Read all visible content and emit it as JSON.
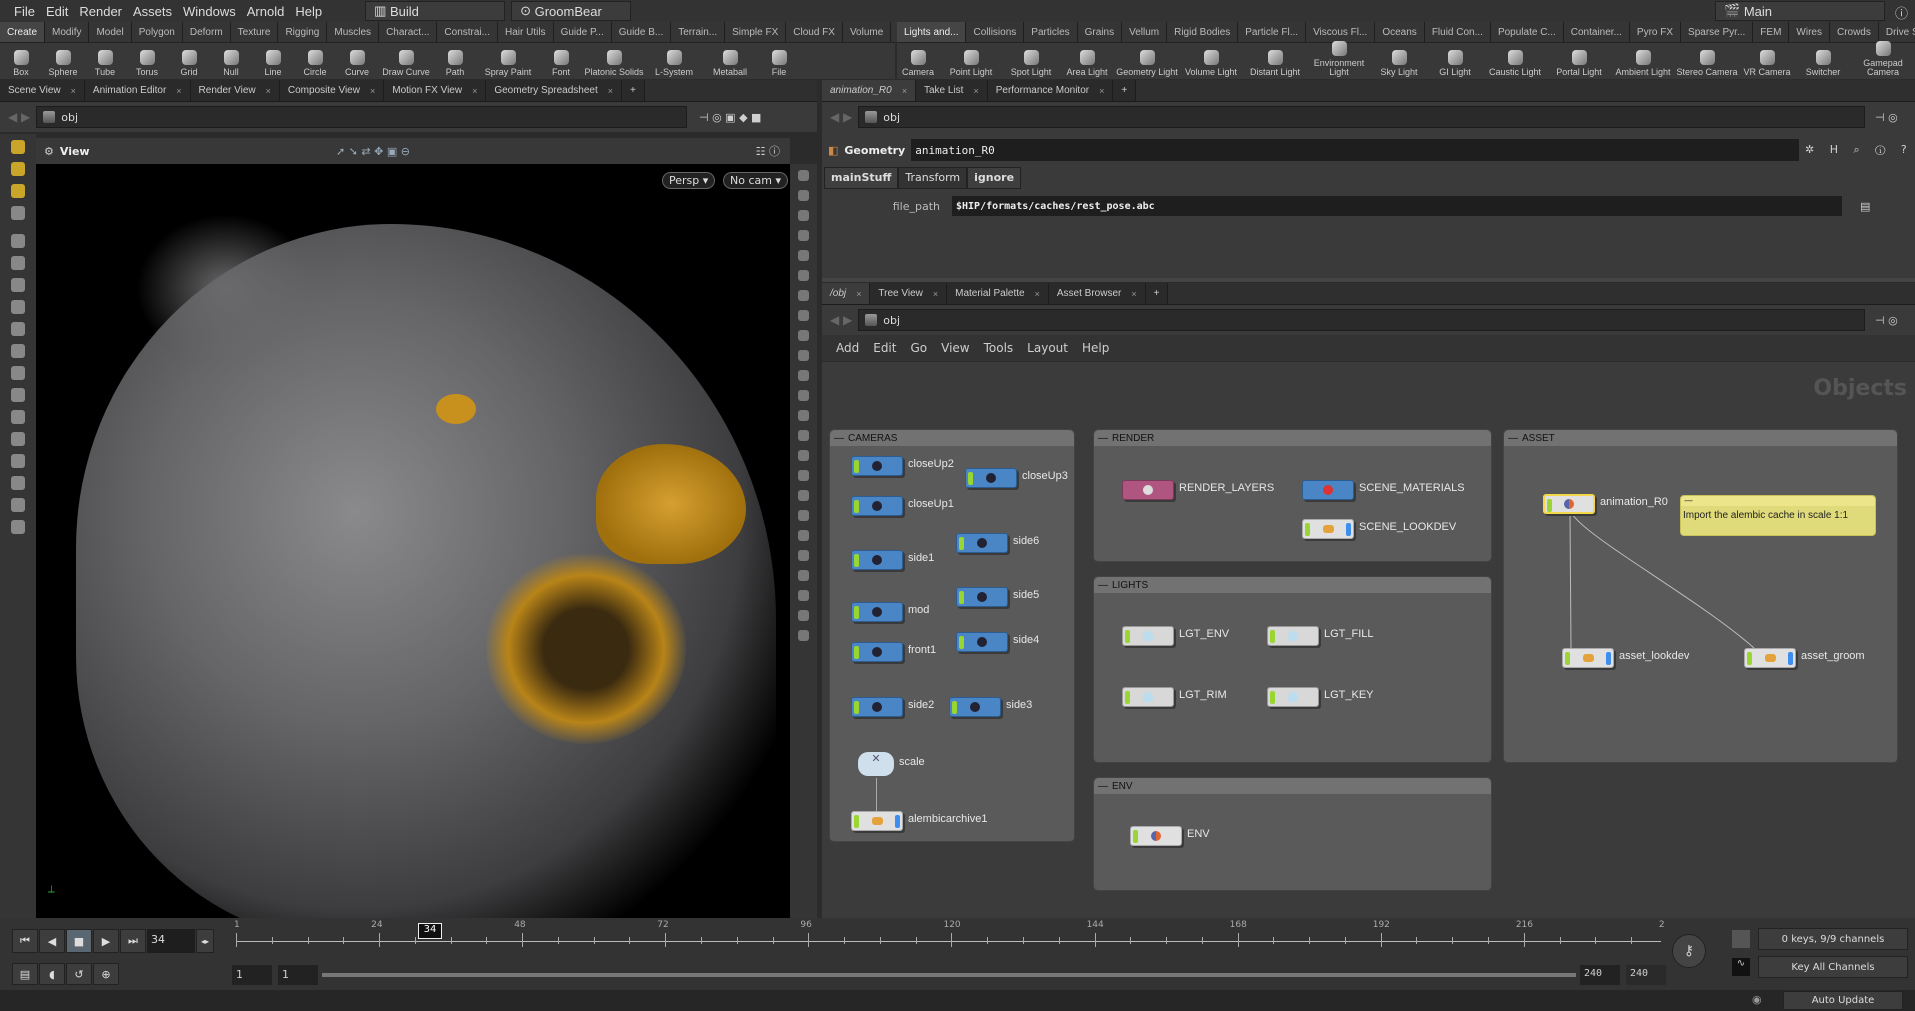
{
  "menu": [
    "File",
    "Edit",
    "Render",
    "Assets",
    "Windows",
    "Arnold",
    "Help"
  ],
  "desktop": "Build",
  "scene": "GroomBear",
  "main_desktop": "Main",
  "shelf_left": {
    "tabs": [
      "Create",
      "Modify",
      "Model",
      "Polygon",
      "Deform",
      "Texture",
      "Rigging",
      "Muscles",
      "Charact...",
      "Constrai...",
      "Hair Utils",
      "Guide P...",
      "Guide B...",
      "Terrain...",
      "Simple FX",
      "Cloud FX",
      "Volume"
    ],
    "tools": [
      "Box",
      "Sphere",
      "Tube",
      "Torus",
      "Grid",
      "Null",
      "Line",
      "Circle",
      "Curve",
      "Draw Curve",
      "Path",
      "Spray Paint",
      "Font",
      "Platonic Solids",
      "L-System",
      "Metaball",
      "File"
    ]
  },
  "shelf_right": {
    "tabs": [
      "Lights and...",
      "Collisions",
      "Particles",
      "Grains",
      "Vellum",
      "Rigid Bodies",
      "Particle Fl...",
      "Viscous Fl...",
      "Oceans",
      "Fluid Con...",
      "Populate C...",
      "Container...",
      "Pyro FX",
      "Sparse Pyr...",
      "FEM",
      "Wires",
      "Crowds",
      "Drive Sim..."
    ],
    "tools": [
      "Camera",
      "Point Light",
      "Spot Light",
      "Area Light",
      "Geometry Light",
      "Volume Light",
      "Distant Light",
      "Environment Light",
      "Sky Light",
      "GI Light",
      "Caustic Light",
      "Portal Light",
      "Ambient Light",
      "Stereo Camera",
      "VR Camera",
      "Switcher",
      "Gamepad Camera"
    ]
  },
  "left_pane": {
    "tabs": [
      "Scene View",
      "Animation Editor",
      "Render View",
      "Composite View",
      "Motion FX View",
      "Geometry Spreadsheet"
    ],
    "path": "obj",
    "view_label": "View",
    "persp": "Persp ▾",
    "camera": "No cam ▾"
  },
  "param_pane": {
    "tabs": [
      "animation_R0",
      "Take List",
      "Performance Monitor"
    ],
    "path": "obj",
    "node_type": "Geometry",
    "node_name": "animation_R0",
    "param_tabs": [
      "mainStuff",
      "Transform",
      "ignore"
    ],
    "file_path_label": "file_path",
    "file_path_value": "$HIP/formats/caches/rest_pose.abc"
  },
  "network_pane": {
    "tabs": [
      "/obj",
      "Tree View",
      "Material Palette",
      "Asset Browser"
    ],
    "path": "obj",
    "menu": [
      "Add",
      "Edit",
      "Go",
      "View",
      "Tools",
      "Layout",
      "Help"
    ],
    "context": "Objects",
    "boxes": {
      "cameras": {
        "title": "CAMERAS",
        "nodes": [
          "closeUp2",
          "closeUp3",
          "closeUp1",
          "side6",
          "side1",
          "side5",
          "mod",
          "side4",
          "front1",
          "side2",
          "side3",
          "scale",
          "alembicarchive1"
        ]
      },
      "render": {
        "title": "RENDER",
        "nodes": [
          "RENDER_LAYERS",
          "SCENE_MATERIALS",
          "SCENE_LOOKDEV"
        ]
      },
      "lights": {
        "title": "LIGHTS",
        "nodes": [
          "LGT_ENV",
          "LGT_FILL",
          "LGT_RIM",
          "LGT_KEY"
        ]
      },
      "env": {
        "title": "ENV",
        "nodes": [
          "ENV"
        ]
      },
      "asset": {
        "title": "ASSET",
        "nodes": [
          "animation_R0",
          "asset_lookdev",
          "asset_groom"
        ],
        "sticky_note": "Import the alembic cache in scale 1:1"
      }
    }
  },
  "timeline": {
    "current_frame": "34",
    "frame_marker": "34",
    "ticks": [
      "1",
      "24",
      "48",
      "72",
      "96",
      "120",
      "144",
      "168",
      "192",
      "216",
      "2"
    ],
    "range_start": "1",
    "range_start2": "1",
    "range_end": "240",
    "range_end2": "240",
    "keys_status": "0 keys, 9/9 channels",
    "key_mode": "Key All Channels",
    "update_mode": "Auto Update"
  },
  "colors": {
    "camera_node": "#4a86c6",
    "rop_node": "#b05580",
    "sticky": "#e6e07a",
    "selected": "#f4d84a",
    "bear_fur": "#6e6e70",
    "muzzle": "#c8901c"
  }
}
